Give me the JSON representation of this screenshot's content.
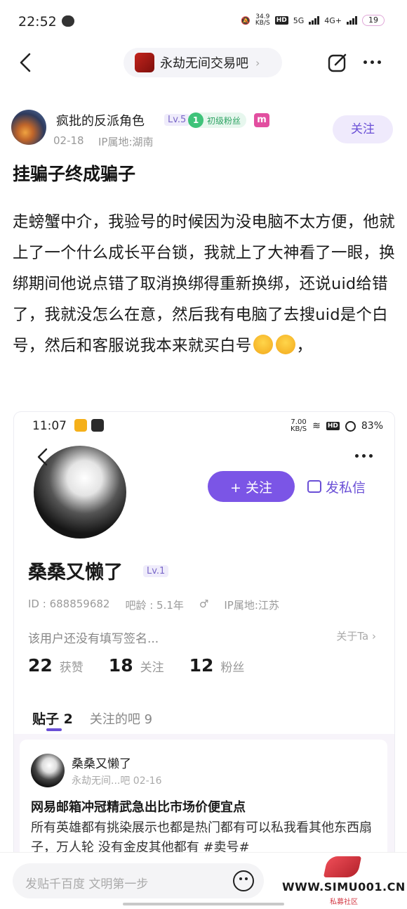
{
  "status_bar": {
    "time": "22:52",
    "speed_top": "34.9",
    "speed_unit": "KB/S",
    "net1": "5G",
    "net2": "4G+",
    "battery": "19"
  },
  "nav": {
    "forum_name": "永劫无间交易吧",
    "chevron": "›"
  },
  "author": {
    "name": "疯批的反派角色",
    "level": "Lv.5",
    "fan_level_num": "1",
    "fan_level_text": "初级粉丝",
    "badge_m": "m",
    "date": "02-18",
    "ip": "IP属地:湖南",
    "follow_label": "关注"
  },
  "post": {
    "title": "挂骗子终成骗子",
    "body": "走螃蟹中介，我验号的时候因为没电脑不太方便，他就上了一个什么成长平台锁，我就上了大神看了一眼，换绑期间他说点错了取消换绑得重新换绑，还说uid给错了，我就没怎么在意，然后我有电脑了去搜uid是个白号，然后和客服说我本来就买白号",
    "body_tail": "，"
  },
  "embedded": {
    "time": "11:07",
    "speed": "7.00",
    "speed_unit": "KB/S",
    "battery": "83%",
    "follow_label": "+ 关注",
    "message_label": "发私信",
    "name": "桑桑又懒了",
    "level": "Lv.1",
    "id": "ID : 688859682",
    "bar_age": "吧龄 : 5.1年",
    "gender_icon": "♂",
    "ip": "IP属地:江苏",
    "signature": "该用户还没有填写签名...",
    "about": "关于Ta ›",
    "stats": [
      {
        "num": "22",
        "label": "获赞"
      },
      {
        "num": "18",
        "label": "关注"
      },
      {
        "num": "12",
        "label": "粉丝"
      }
    ],
    "tab_active": "贴子 2",
    "tab_other": "关注的吧 9",
    "card": {
      "name": "桑桑又懒了",
      "sub": "永劫无间...吧  02-16",
      "title": "网易邮箱冲冠精武急出比市场价便宜点",
      "body": "所有英雄都有挑染展示也都是热门都有可以私我看其他东西扇子，万人轮 没有金皮其他都有 #卖号#"
    }
  },
  "reply": {
    "placeholder": "发贴千百度 文明第一步"
  },
  "watermark": {
    "text": "WWW.SIMU001.CN",
    "sub": "私募社区"
  }
}
